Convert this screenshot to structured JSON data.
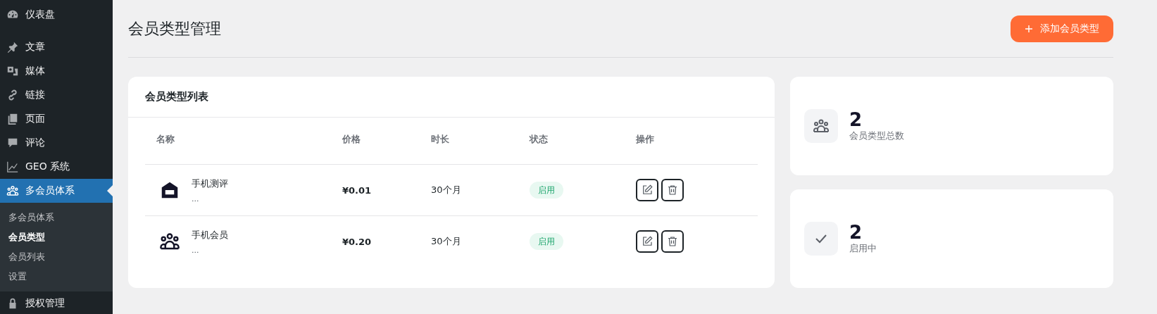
{
  "sidebar": {
    "items": [
      {
        "label": "仪表盘",
        "kind": "gauge",
        "selected": false
      },
      {
        "label": "文章",
        "kind": "pin",
        "selected": false
      },
      {
        "label": "媒体",
        "kind": "media",
        "selected": false
      },
      {
        "label": "链接",
        "kind": "link",
        "selected": false
      },
      {
        "label": "页面",
        "kind": "pages",
        "selected": false
      },
      {
        "label": "评论",
        "kind": "comment",
        "selected": false
      },
      {
        "label": "GEO 系统",
        "kind": "chart",
        "selected": false
      },
      {
        "label": "多会员体系",
        "kind": "people",
        "selected": true,
        "children": [
          {
            "label": "多会员体系",
            "selected": false
          },
          {
            "label": "会员类型",
            "selected": true
          },
          {
            "label": "会员列表",
            "selected": false
          },
          {
            "label": "设置",
            "selected": false
          }
        ]
      },
      {
        "label": "授权管理",
        "kind": "lock",
        "selected": false
      }
    ]
  },
  "page": {
    "title": "会员类型管理",
    "add_button": "添加会员类型"
  },
  "list_card": {
    "title": "会员类型列表",
    "columns": [
      "名称",
      "价格",
      "时长",
      "状态",
      "操作"
    ],
    "rows": [
      {
        "kind": "house",
        "name": "手机测评",
        "description": "...",
        "price": "¥0.01",
        "duration": "30个月",
        "status": "启用"
      },
      {
        "kind": "people",
        "name": "手机会员",
        "description": "...",
        "price": "¥0.20",
        "duration": "30个月",
        "status": "启用"
      }
    ]
  },
  "stats": [
    {
      "kind": "people",
      "value": "2",
      "label": "会员类型总数"
    },
    {
      "kind": "check",
      "value": "2",
      "label": "启用中"
    }
  ]
}
